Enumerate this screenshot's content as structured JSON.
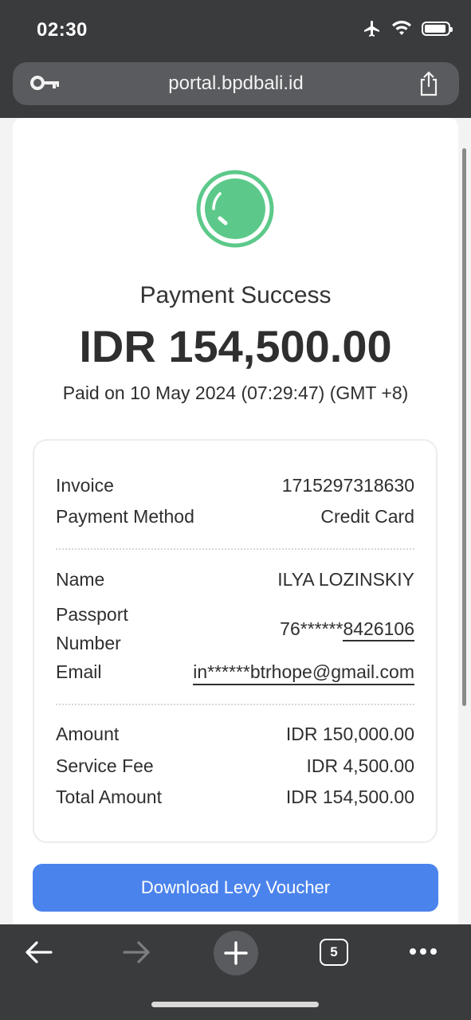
{
  "status_bar": {
    "time": "02:30"
  },
  "browser": {
    "url": "portal.bpdbali.id",
    "tab_count": "5"
  },
  "receipt": {
    "title": "Payment Success",
    "amount": "IDR 154,500.00",
    "paid_on": "Paid on 10 May 2024 (07:29:47) (GMT +8)",
    "rows": {
      "invoice": {
        "label": "Invoice",
        "value": "1715297318630"
      },
      "payment_method": {
        "label": "Payment Method",
        "value": "Credit Card"
      },
      "name": {
        "label": "Name",
        "value": "ILYA LOZINSKIY"
      },
      "passport": {
        "label_line1": "Passport",
        "label_line2": "Number",
        "value_prefix": "76******",
        "value_suffix": "8426106"
      },
      "email": {
        "label": "Email",
        "value": "in******btrhope@gmail.com"
      },
      "amount": {
        "label": "Amount",
        "value": "IDR 150,000.00"
      },
      "service_fee": {
        "label": "Service Fee",
        "value": "IDR 4,500.00"
      },
      "total": {
        "label": "Total Amount",
        "value": "IDR 154,500.00"
      }
    },
    "download_button": "Download Levy Voucher"
  },
  "colors": {
    "accent": "#4b83ec",
    "success": "#5cc98a",
    "toolbar": "#3a3b3d"
  }
}
